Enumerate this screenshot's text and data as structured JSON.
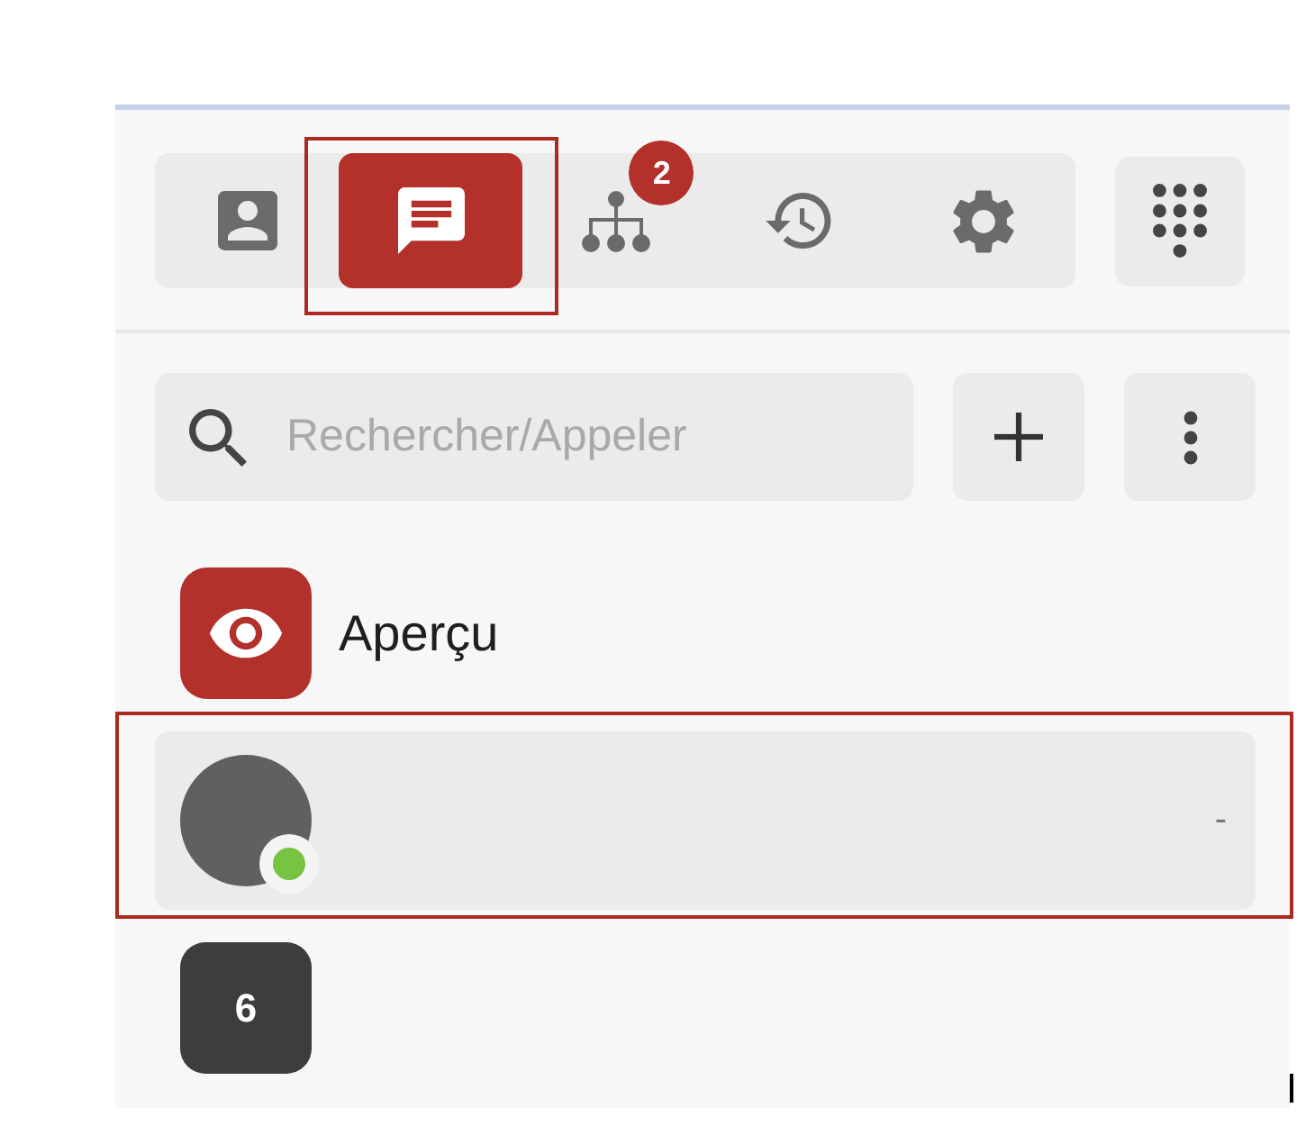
{
  "toolbar": {
    "tabs": [
      {
        "kind": "contacts",
        "selected": false,
        "highlighted": false
      },
      {
        "kind": "messages",
        "selected": true,
        "highlighted": true
      },
      {
        "kind": "org_chart",
        "selected": false,
        "highlighted": false,
        "badge": "2"
      },
      {
        "kind": "history",
        "selected": false,
        "highlighted": false
      },
      {
        "kind": "settings",
        "selected": false,
        "highlighted": false
      }
    ]
  },
  "search": {
    "placeholder": "Rechercher/Appeler"
  },
  "conversations": [
    {
      "kind": "preview",
      "title": "Aperçu",
      "selected": false,
      "highlighted": false
    },
    {
      "kind": "contact",
      "color": "#76c442",
      "meta": "-",
      "selected": true,
      "highlighted": true
    },
    {
      "kind": "group",
      "count": "6",
      "selected": false,
      "highlighted": false
    }
  ]
}
